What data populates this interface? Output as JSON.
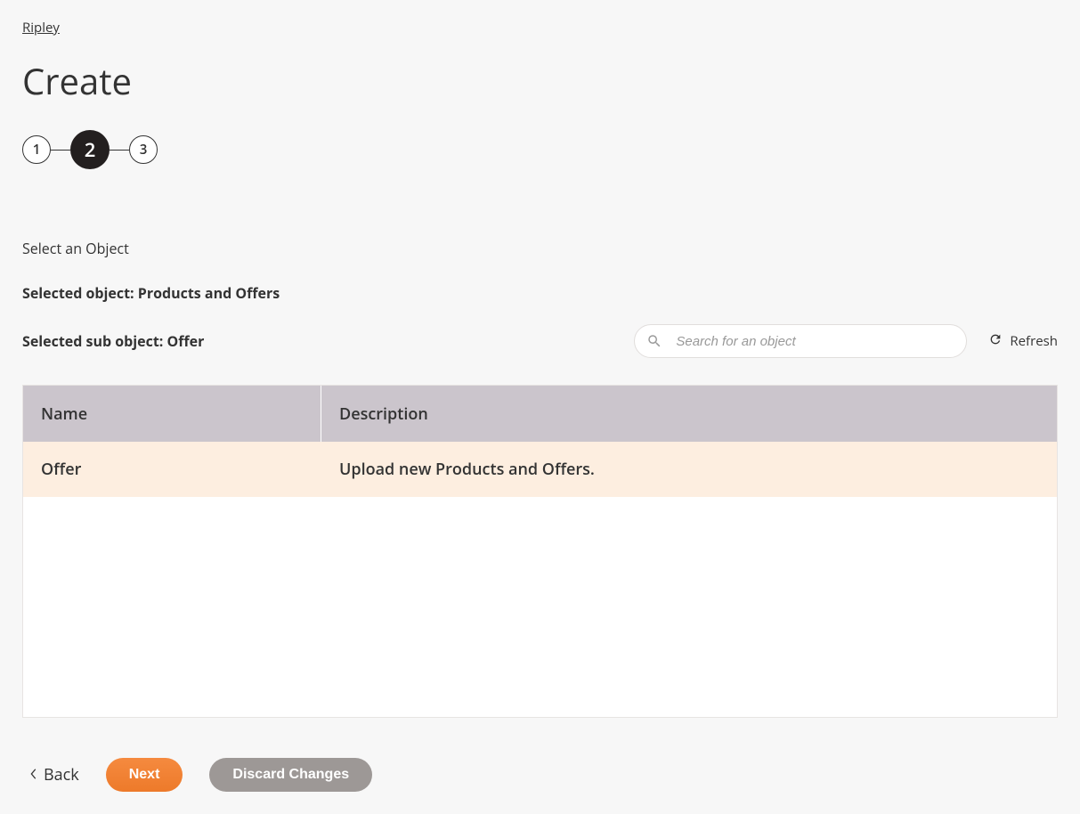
{
  "breadcrumb": {
    "label": "Ripley"
  },
  "page": {
    "title": "Create"
  },
  "stepper": {
    "steps": [
      "1",
      "2",
      "3"
    ],
    "active_index": 1
  },
  "section": {
    "label": "Select an Object"
  },
  "selected": {
    "object_label": "Selected object: Products and Offers",
    "sub_object_label": "Selected sub object: Offer"
  },
  "search": {
    "placeholder": "Search for an object",
    "value": ""
  },
  "refresh": {
    "label": "Refresh"
  },
  "table": {
    "columns": {
      "name": "Name",
      "description": "Description"
    },
    "rows": [
      {
        "name": "Offer",
        "description": "Upload new Products and Offers."
      }
    ]
  },
  "footer": {
    "back_label": "Back",
    "next_label": "Next",
    "discard_label": "Discard Changes"
  }
}
